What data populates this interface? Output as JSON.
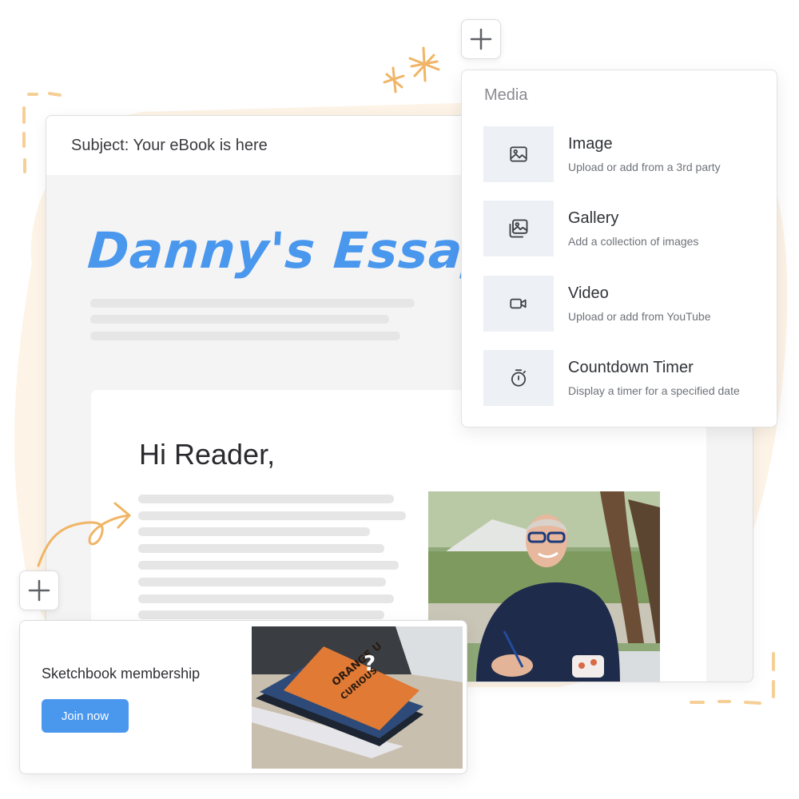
{
  "colors": {
    "accent_blue": "#4a97ee",
    "decoration_orange": "#f0b566",
    "icon_box_bg": "#edf1f5",
    "placeholder_gray": "#e6e6e6"
  },
  "email": {
    "subject": "Subject: Your eBook is here",
    "logo_text": "Danny's Essays",
    "greeting": "Hi Reader,",
    "photo_alt": "man-writing-at-outdoor-table-photo"
  },
  "media_panel": {
    "title": "Media",
    "items": [
      {
        "icon": "image-icon",
        "label": "Image",
        "description": "Upload or add from a 3rd party"
      },
      {
        "icon": "gallery-icon",
        "label": "Gallery",
        "description": "Add a collection of images"
      },
      {
        "icon": "video-camera-icon",
        "label": "Video",
        "description": "Upload or add from YouTube"
      },
      {
        "icon": "stopwatch-icon",
        "label": "Countdown Timer",
        "description": "Display a timer for a specified date"
      }
    ]
  },
  "membership": {
    "title": "Sketchbook membership",
    "button_label": "Join now",
    "photo_alt": "orange-sketchbook-on-desk-photo"
  },
  "add_buttons": [
    {
      "icon": "plus-icon"
    },
    {
      "icon": "plus-icon"
    }
  ]
}
